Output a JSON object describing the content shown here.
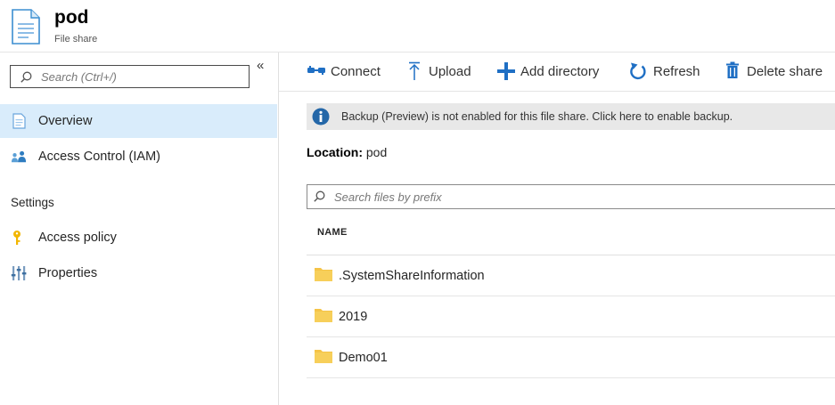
{
  "header": {
    "title": "pod",
    "subtitle": "File share",
    "icon": "file-share-document-icon"
  },
  "sidebar": {
    "search_placeholder": "Search (Ctrl+/)",
    "search_value": "",
    "collapse_glyph": "«",
    "items": [
      {
        "label": "Overview",
        "icon": "overview-document-icon",
        "active": true
      },
      {
        "label": "Access Control (IAM)",
        "icon": "iam-people-icon",
        "active": false
      }
    ],
    "section_settings": "Settings",
    "settings_items": [
      {
        "label": "Access policy",
        "icon": "key-icon"
      },
      {
        "label": "Properties",
        "icon": "properties-sliders-icon"
      }
    ]
  },
  "toolbar": {
    "connect": "Connect",
    "upload": "Upload",
    "add_directory": "Add directory",
    "refresh": "Refresh",
    "delete_share": "Delete share"
  },
  "banner": {
    "message": "Backup (Preview) is not enabled for this file share. Click here to enable backup."
  },
  "location": {
    "label": "Location:",
    "value": "pod"
  },
  "files": {
    "search_placeholder": "Search files by prefix",
    "search_value": "",
    "column_name": "NAME",
    "rows": [
      {
        "name": ".SystemShareInformation",
        "icon": "folder-icon"
      },
      {
        "name": "2019",
        "icon": "folder-icon"
      },
      {
        "name": "Demo01",
        "icon": "folder-icon"
      }
    ]
  },
  "colors": {
    "accent": "#0078d4",
    "active_nav_bg": "#d9ecfb",
    "banner_bg": "#e8e8e8",
    "folder": "#f5c447",
    "key": "#f2b600"
  }
}
